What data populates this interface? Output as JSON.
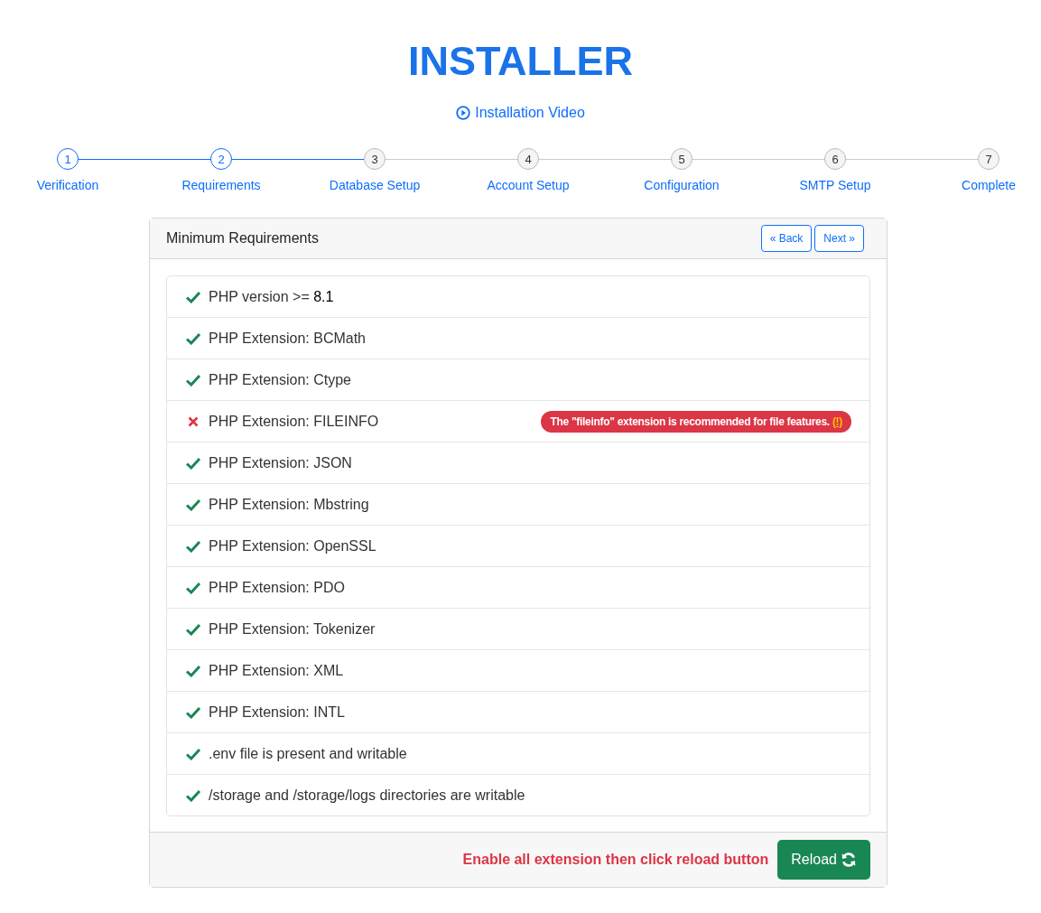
{
  "title": "INSTALLER",
  "video_link": "Installation Video",
  "steps": [
    {
      "number": "1",
      "label": "Verification",
      "reached": true
    },
    {
      "number": "2",
      "label": "Requirements",
      "reached": true
    },
    {
      "number": "3",
      "label": "Database Setup",
      "reached": false
    },
    {
      "number": "4",
      "label": "Account Setup",
      "reached": false
    },
    {
      "number": "5",
      "label": "Configuration",
      "reached": false
    },
    {
      "number": "6",
      "label": "SMTP Setup",
      "reached": false
    },
    {
      "number": "7",
      "label": "Complete",
      "reached": false
    }
  ],
  "card": {
    "title": "Minimum Requirements",
    "back_button": "« Back",
    "next_button": "Next »",
    "requirements": [
      {
        "label": "PHP version >= ",
        "value": "8.1",
        "passed": true
      },
      {
        "label": "PHP Extension: BCMath",
        "passed": true
      },
      {
        "label": "PHP Extension: Ctype",
        "passed": true
      },
      {
        "label": "PHP Extension: FILEINFO",
        "passed": false,
        "note": "The \"fileinfo\" extension is recommended for file features.",
        "note_mark": "(!)"
      },
      {
        "label": "PHP Extension: JSON",
        "passed": true
      },
      {
        "label": "PHP Extension: Mbstring",
        "passed": true
      },
      {
        "label": "PHP Extension: OpenSSL",
        "passed": true
      },
      {
        "label": "PHP Extension: PDO",
        "passed": true
      },
      {
        "label": "PHP Extension: Tokenizer",
        "passed": true
      },
      {
        "label": "PHP Extension: XML",
        "passed": true
      },
      {
        "label": "PHP Extension: INTL",
        "passed": true
      },
      {
        "label": ".env file is present and writable",
        "passed": true
      },
      {
        "label": "/storage and /storage/logs directories are writable",
        "passed": true
      }
    ],
    "footer_message": "Enable all extension then click reload button",
    "reload_button": "Reload"
  }
}
